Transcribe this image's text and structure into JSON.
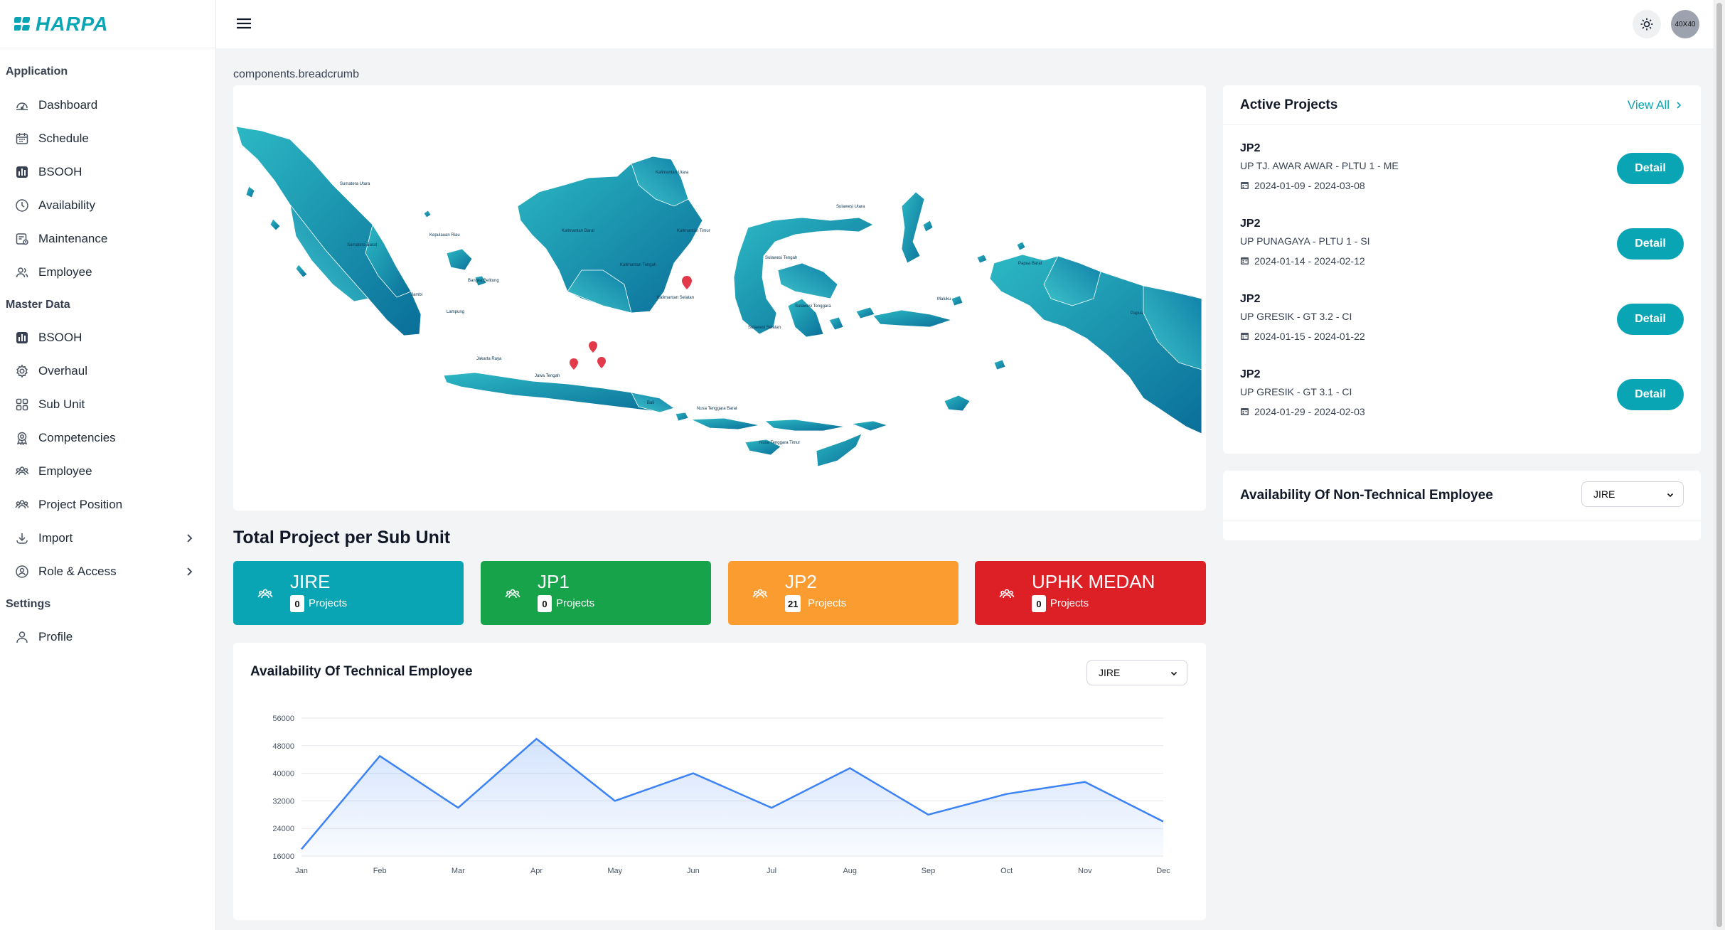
{
  "app": {
    "logo_text": "HARPA"
  },
  "sidebar": {
    "sections": [
      {
        "title": "Application"
      },
      {
        "title": "Master Data"
      },
      {
        "title": "Settings"
      }
    ],
    "application": [
      {
        "label": "Dashboard",
        "icon": "dashboard-icon"
      },
      {
        "label": "Schedule",
        "icon": "calendar-icon"
      },
      {
        "label": "BSOOH",
        "icon": "chart-icon"
      },
      {
        "label": "Availability",
        "icon": "clock-icon"
      },
      {
        "label": "Maintenance",
        "icon": "maintenance-icon"
      },
      {
        "label": "Employee",
        "icon": "users-icon"
      }
    ],
    "master": [
      {
        "label": "BSOOH",
        "icon": "chart-icon"
      },
      {
        "label": "Overhaul",
        "icon": "gear-icon"
      },
      {
        "label": "Sub Unit",
        "icon": "grid-icon"
      },
      {
        "label": "Competencies",
        "icon": "badge-icon"
      },
      {
        "label": "Employee",
        "icon": "users-icon"
      },
      {
        "label": "Project Position",
        "icon": "users-icon"
      },
      {
        "label": "Import",
        "icon": "download-icon"
      },
      {
        "label": "Role & Access",
        "icon": "shield-icon"
      }
    ],
    "settings": [
      {
        "label": "Profile",
        "icon": "user-icon"
      }
    ]
  },
  "header": {
    "avatar_text": "40X40"
  },
  "breadcrumb": "components.breadcrumb",
  "map": {
    "labels": [
      "Sumatera Utara",
      "Sumatera Barat",
      "Kepulauan Riau",
      "Jambi",
      "Bangka Belitung",
      "Lampung",
      "Jakarta Raya",
      "Jawa Tengah",
      "Bali",
      "Nusa Tenggara Barat",
      "Nusa Tenggara Timur",
      "Kalimantan Barat",
      "Kalimantan Tengah",
      "Kalimantan Timur",
      "Kalimantan Utara",
      "Kalimantan Selatan",
      "Sulawesi Utara",
      "Sulawesi Tengah",
      "Sulawesi Tenggara",
      "Sulawesi Selatan",
      "Maluku",
      "Papua Barat",
      "Papua"
    ]
  },
  "total_section": {
    "title": "Total Project per Sub Unit",
    "units": [
      {
        "name": "JIRE",
        "count": "0",
        "unit_label": "Projects",
        "color": "#0aa5b4"
      },
      {
        "name": "JP1",
        "count": "0",
        "unit_label": "Projects",
        "color": "#16a34a"
      },
      {
        "name": "JP2",
        "count": "21",
        "unit_label": "Projects",
        "color": "#fb9c30"
      },
      {
        "name": "UPHK MEDAN",
        "count": "0",
        "unit_label": "Projects",
        "color": "#dc2026"
      }
    ]
  },
  "tech_chart": {
    "title": "Availability Of Technical Employee",
    "select_value": "JIRE"
  },
  "chart_data": {
    "type": "area",
    "categories": [
      "Jan",
      "Feb",
      "Mar",
      "Apr",
      "May",
      "Jun",
      "Jul",
      "Aug",
      "Sep",
      "Oct",
      "Nov",
      "Dec"
    ],
    "series": [
      {
        "values": [
          18000,
          45000,
          30000,
          50000,
          32000,
          40000,
          30000,
          41500,
          28000,
          34000,
          37500,
          26000
        ]
      }
    ],
    "yticks": [
      16000,
      24000,
      32000,
      40000,
      48000,
      56000
    ],
    "ylim": [
      16000,
      56000
    ],
    "xlabel": "",
    "ylabel": "",
    "grid": true,
    "line_color": "#3b82f6"
  },
  "active_projects": {
    "title": "Active Projects",
    "view_all": "View All",
    "button_label": "Detail",
    "items": [
      {
        "code": "JP2",
        "name": "UP TJ. AWAR AWAR - PLTU 1 - ME",
        "dates": "2024-01-09 - 2024-03-08"
      },
      {
        "code": "JP2",
        "name": "UP PUNAGAYA - PLTU 1 - SI",
        "dates": "2024-01-14 - 2024-02-12"
      },
      {
        "code": "JP2",
        "name": "UP GRESIK - GT 3.2 - CI",
        "dates": "2024-01-15 - 2024-01-22"
      },
      {
        "code": "JP2",
        "name": "UP GRESIK - GT 3.1 - CI",
        "dates": "2024-01-29 - 2024-02-03"
      }
    ]
  },
  "nontech": {
    "title": "Availability Of Non-Technical Employee",
    "select_value": "JIRE"
  }
}
